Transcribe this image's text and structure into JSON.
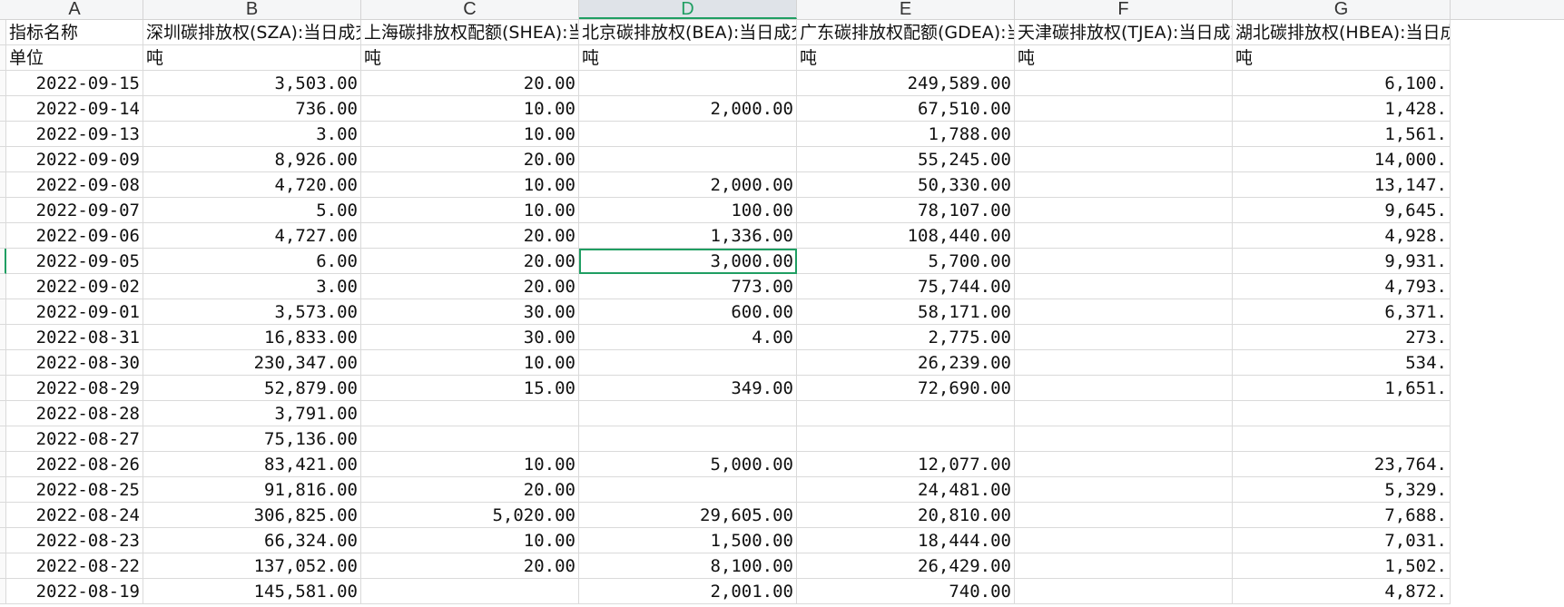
{
  "columns": [
    "A",
    "B",
    "C",
    "D",
    "E",
    "F",
    "G"
  ],
  "active_column": "D",
  "headers": [
    "指标名称",
    "深圳碳排放权(SZA):当日成交量",
    "上海碳排放权配额(SHEA):当日成交量",
    "北京碳排放权(BEA):当日成交量",
    "广东碳排放权配额(GDEA):当日成交量",
    "天津碳排放权(TJEA):当日成交量",
    "湖北碳排放权(HBEA):当日成交量"
  ],
  "units": [
    "单位",
    "吨",
    "吨",
    "吨",
    "吨",
    "吨",
    "吨"
  ],
  "rows": [
    [
      "2022-09-15",
      "3,503.00",
      "20.00",
      "",
      "249,589.00",
      "",
      "6,100."
    ],
    [
      "2022-09-14",
      "736.00",
      "10.00",
      "2,000.00",
      "67,510.00",
      "",
      "1,428."
    ],
    [
      "2022-09-13",
      "3.00",
      "10.00",
      "",
      "1,788.00",
      "",
      "1,561."
    ],
    [
      "2022-09-09",
      "8,926.00",
      "20.00",
      "",
      "55,245.00",
      "",
      "14,000."
    ],
    [
      "2022-09-08",
      "4,720.00",
      "10.00",
      "2,000.00",
      "50,330.00",
      "",
      "13,147."
    ],
    [
      "2022-09-07",
      "5.00",
      "10.00",
      "100.00",
      "78,107.00",
      "",
      "9,645."
    ],
    [
      "2022-09-06",
      "4,727.00",
      "20.00",
      "1,336.00",
      "108,440.00",
      "",
      "4,928."
    ],
    [
      "2022-09-05",
      "6.00",
      "20.00",
      "3,000.00",
      "5,700.00",
      "",
      "9,931."
    ],
    [
      "2022-09-02",
      "3.00",
      "20.00",
      "773.00",
      "75,744.00",
      "",
      "4,793."
    ],
    [
      "2022-09-01",
      "3,573.00",
      "30.00",
      "600.00",
      "58,171.00",
      "",
      "6,371."
    ],
    [
      "2022-08-31",
      "16,833.00",
      "30.00",
      "4.00",
      "2,775.00",
      "",
      "273."
    ],
    [
      "2022-08-30",
      "230,347.00",
      "10.00",
      "",
      "26,239.00",
      "",
      "534."
    ],
    [
      "2022-08-29",
      "52,879.00",
      "15.00",
      "349.00",
      "72,690.00",
      "",
      "1,651."
    ],
    [
      "2022-08-28",
      "3,791.00",
      "",
      "",
      "",
      "",
      ""
    ],
    [
      "2022-08-27",
      "75,136.00",
      "",
      "",
      "",
      "",
      ""
    ],
    [
      "2022-08-26",
      "83,421.00",
      "10.00",
      "5,000.00",
      "12,077.00",
      "",
      "23,764."
    ],
    [
      "2022-08-25",
      "91,816.00",
      "20.00",
      "",
      "24,481.00",
      "",
      "5,329."
    ],
    [
      "2022-08-24",
      "306,825.00",
      "5,020.00",
      "29,605.00",
      "20,810.00",
      "",
      "7,688."
    ],
    [
      "2022-08-23",
      "66,324.00",
      "10.00",
      "1,500.00",
      "18,444.00",
      "",
      "7,031."
    ],
    [
      "2022-08-22",
      "137,052.00",
      "20.00",
      "8,100.00",
      "26,429.00",
      "",
      "1,502."
    ],
    [
      "2022-08-19",
      "145,581.00",
      "",
      "2,001.00",
      "740.00",
      "",
      "4,872."
    ]
  ],
  "selected_cell": {
    "row": 7,
    "col": 3
  }
}
